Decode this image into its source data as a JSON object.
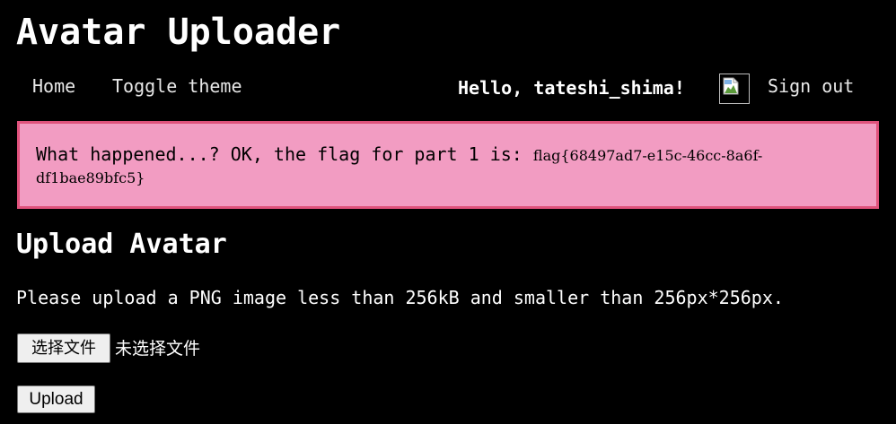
{
  "header": {
    "title": "Avatar Uploader"
  },
  "nav": {
    "home": "Home",
    "toggle_theme": "Toggle theme",
    "greeting": "Hello, tateshi_shima!",
    "sign_out": "Sign out",
    "avatar_icon": "broken-image-icon"
  },
  "alert": {
    "message": "What happened...? OK, the flag for part 1 is: ",
    "flag_part1": "flag{68497ad7-e15c-46cc-8a6f-",
    "flag_part2": "df1bae89bfc5}",
    "background_color": "#f29cc2",
    "border_color": "#e0527c"
  },
  "upload": {
    "title": "Upload Avatar",
    "instructions": "Please upload a PNG image less than 256kB and smaller than 256px*256px.",
    "file_button_label": "选择文件",
    "file_status": "未选择文件",
    "submit_label": "Upload"
  }
}
